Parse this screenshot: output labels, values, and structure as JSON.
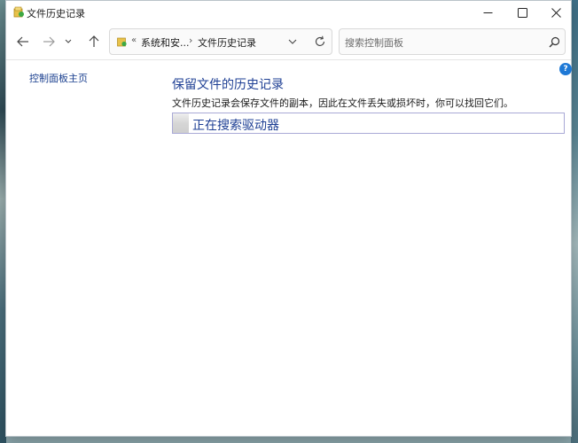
{
  "window": {
    "title": "文件历史记录",
    "controls": {
      "minimize": "—",
      "maximize": "☐",
      "close": "✕"
    }
  },
  "nav": {
    "back_icon": "arrow-left-icon",
    "forward_icon": "arrow-right-icon",
    "recent_icon": "chevron-down-icon",
    "up_icon": "arrow-up-icon"
  },
  "address": {
    "overflow": "«",
    "crumb1": "系统和安...",
    "separator": "›",
    "crumb2": "文件历史记录"
  },
  "search": {
    "placeholder": "搜索控制面板"
  },
  "sidebar": {
    "home_link": "控制面板主页"
  },
  "main": {
    "title": "保留文件的历史记录",
    "description": "文件历史记录会保存文件的副本，因此在文件丢失或损坏时，你可以找回它们。",
    "status_text": "正在搜索驱动器",
    "progress": 0.04
  },
  "colors": {
    "link": "#1a3f8f",
    "heading": "#1e3f94",
    "help": "#1e79d6",
    "status_border": "#a9a9d6"
  }
}
